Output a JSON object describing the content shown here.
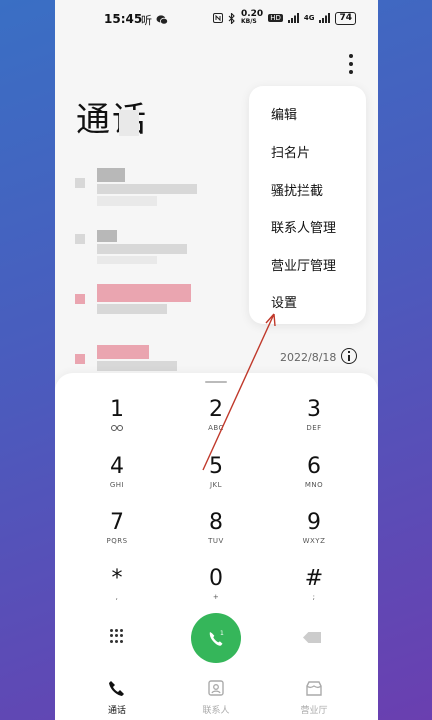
{
  "status_bar": {
    "time": "15:45",
    "left_icons": "听",
    "speed": "0.20",
    "speed_unit": "KB/S",
    "hd_badge": "HD",
    "signal": "4G",
    "battery": "74"
  },
  "header": {
    "title": "通话"
  },
  "menu": {
    "items": [
      {
        "label": "编辑"
      },
      {
        "label": "扫名片"
      },
      {
        "label": "骚扰拦截"
      },
      {
        "label": "联系人管理"
      },
      {
        "label": "营业厅管理"
      },
      {
        "label": "设置"
      }
    ]
  },
  "call_log": {
    "last_date": "2022/8/18"
  },
  "dialpad": {
    "keys": [
      {
        "digit": "1",
        "letters": ""
      },
      {
        "digit": "2",
        "letters": "ABC"
      },
      {
        "digit": "3",
        "letters": "DEF"
      },
      {
        "digit": "4",
        "letters": "GHI"
      },
      {
        "digit": "5",
        "letters": "JKL"
      },
      {
        "digit": "6",
        "letters": "MNO"
      },
      {
        "digit": "7",
        "letters": "PQRS"
      },
      {
        "digit": "8",
        "letters": "TUV"
      },
      {
        "digit": "9",
        "letters": "WXYZ"
      },
      {
        "digit": "*",
        "letters": ","
      },
      {
        "digit": "0",
        "letters": "+"
      },
      {
        "digit": "#",
        "letters": ";"
      }
    ]
  },
  "bottom_nav": {
    "tabs": [
      {
        "label": "通话",
        "icon": "phone-icon",
        "active": true
      },
      {
        "label": "联系人",
        "icon": "contact-card-icon",
        "active": false
      },
      {
        "label": "营业厅",
        "icon": "store-icon",
        "active": false
      }
    ]
  },
  "colors": {
    "call_button": "#35b65a",
    "annotation_arrow": "#c0392b"
  }
}
